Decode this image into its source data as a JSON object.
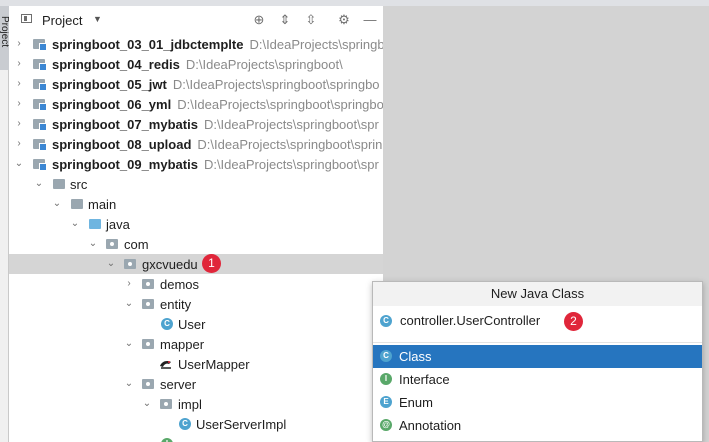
{
  "sidebar": {
    "label": "Project"
  },
  "header": {
    "title": "Project"
  },
  "tree": {
    "modules": [
      {
        "name": "springboot_03_01_jdbctemplte",
        "path": "D:\\IdeaProjects\\springbo"
      },
      {
        "name": "springboot_04_redis",
        "path": "D:\\IdeaProjects\\springboot\\"
      },
      {
        "name": "springboot_05_jwt",
        "path": "D:\\IdeaProjects\\springboot\\springbo"
      },
      {
        "name": "springboot_06_yml",
        "path": "D:\\IdeaProjects\\springboot\\springbo"
      },
      {
        "name": "springboot_07_mybatis",
        "path": "D:\\IdeaProjects\\springboot\\spr"
      },
      {
        "name": "springboot_08_upload",
        "path": "D:\\IdeaProjects\\springboot\\sprin"
      },
      {
        "name": "springboot_09_mybatis",
        "path": "D:\\IdeaProjects\\springboot\\spr"
      }
    ],
    "nodes": {
      "src": "src",
      "main": "main",
      "java": "java",
      "com": "com",
      "gxcvuedu": "gxcvuedu",
      "demos": "demos",
      "entity": "entity",
      "user": "User",
      "mapper": "mapper",
      "usermapper": "UserMapper",
      "server": "server",
      "impl": "impl",
      "userserverimpl": "UserServerImpl"
    }
  },
  "badges": {
    "one": "1",
    "two": "2"
  },
  "popup": {
    "title": "New Java Class",
    "input_value": "controller.UserController",
    "options": [
      {
        "label": "Class",
        "icon_letter": "C",
        "color": "#4ea3cf"
      },
      {
        "label": "Interface",
        "icon_letter": "I",
        "color": "#59a869"
      },
      {
        "label": "Enum",
        "icon_letter": "E",
        "color": "#4ea3cf"
      },
      {
        "label": "Annotation",
        "icon_letter": "@",
        "color": "#59a869"
      }
    ],
    "selected": "Class"
  },
  "colors": {
    "accent": "#2675bf",
    "badge": "#e0263a",
    "selection_row": "#d5d5d5"
  }
}
